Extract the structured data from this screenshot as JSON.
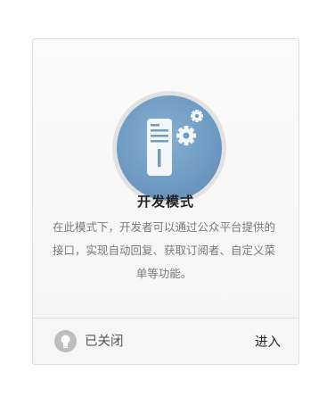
{
  "feature_card": {
    "icon": "developer-server-gear-icon",
    "title": "开发模式",
    "description": "在此模式下，开发者可以通过公众平台提供的接口，实现自动回复、获取订阅者、自定义菜单等功能。"
  },
  "footer": {
    "status_icon": "lightbulb-icon",
    "status_label": "已关闭",
    "enter_label": "进入"
  },
  "colors": {
    "emblem_blue": "#6f9cc4",
    "emblem_ring": "#e2e2e2",
    "card_border": "#dcdcdc",
    "status_icon_gray": "#bdbdbd"
  }
}
